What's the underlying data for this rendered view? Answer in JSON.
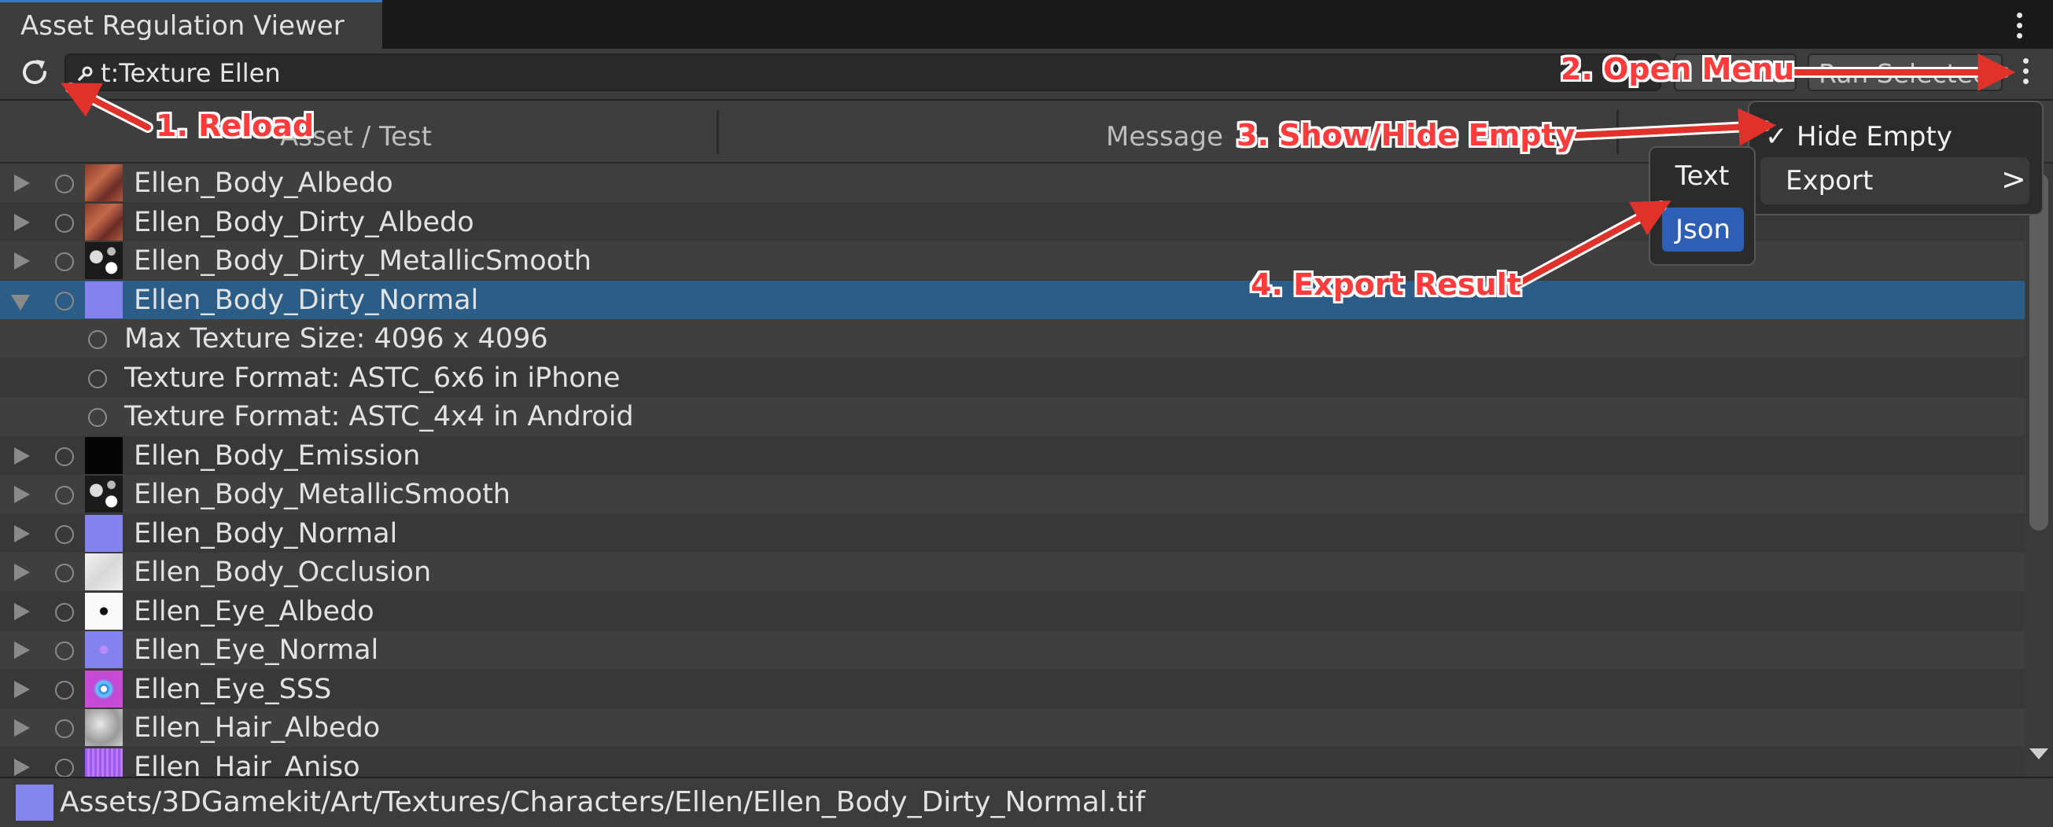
{
  "window": {
    "tab_title": "Asset Regulation Viewer"
  },
  "toolbar": {
    "search_value": "t:Texture Ellen",
    "run_selected_label": "Run Selected"
  },
  "columns": {
    "asset": "Asset / Test",
    "message": "Message"
  },
  "rows": [
    {
      "label": "Ellen_Body_Albedo",
      "kind": "asset",
      "expanded": false,
      "thumb": "albedo"
    },
    {
      "label": "Ellen_Body_Dirty_Albedo",
      "kind": "asset",
      "expanded": false,
      "thumb": "albedo"
    },
    {
      "label": "Ellen_Body_Dirty_MetallicSmooth",
      "kind": "asset",
      "expanded": false,
      "thumb": "metal"
    },
    {
      "label": "Ellen_Body_Dirty_Normal",
      "kind": "asset",
      "expanded": true,
      "selected": true,
      "thumb": "normal"
    },
    {
      "label": "Max Texture Size: 4096 x 4096",
      "kind": "test"
    },
    {
      "label": "Texture Format: ASTC_6x6 in iPhone",
      "kind": "test"
    },
    {
      "label": "Texture Format: ASTC_4x4 in Android",
      "kind": "test"
    },
    {
      "label": "Ellen_Body_Emission",
      "kind": "asset",
      "expanded": false,
      "thumb": "black"
    },
    {
      "label": "Ellen_Body_MetallicSmooth",
      "kind": "asset",
      "expanded": false,
      "thumb": "metal"
    },
    {
      "label": "Ellen_Body_Normal",
      "kind": "asset",
      "expanded": false,
      "thumb": "normal"
    },
    {
      "label": "Ellen_Body_Occlusion",
      "kind": "asset",
      "expanded": false,
      "thumb": "occlusion"
    },
    {
      "label": "Ellen_Eye_Albedo",
      "kind": "asset",
      "expanded": false,
      "thumb": "eye"
    },
    {
      "label": "Ellen_Eye_Normal",
      "kind": "asset",
      "expanded": false,
      "thumb": "eyenormal"
    },
    {
      "label": "Ellen_Eye_SSS",
      "kind": "asset",
      "expanded": false,
      "thumb": "sss"
    },
    {
      "label": "Ellen_Hair_Albedo",
      "kind": "asset",
      "expanded": false,
      "thumb": "hair"
    },
    {
      "label": "Ellen_Hair_Aniso",
      "kind": "asset",
      "expanded": false,
      "thumb": "aniso"
    }
  ],
  "status_bar": {
    "path": "Assets/3DGamekit/Art/Textures/Characters/Ellen/Ellen_Body_Dirty_Normal.tif"
  },
  "context_menu": {
    "hide_empty": {
      "label": "Hide Empty",
      "checked": true,
      "check_glyph": "✓"
    },
    "export": {
      "label": "Export",
      "chevron": ">"
    }
  },
  "export_submenu": {
    "text_label": "Text",
    "json_label": "Json"
  },
  "annotations": {
    "step1": "1. Reload",
    "step2": "2. Open Menu",
    "step3": "3. Show/Hide Empty",
    "step4": "4. Export Result",
    "color": "#ff3b3b"
  },
  "colors": {
    "selection": "#2c5d87",
    "accent_tab": "#3a79bb",
    "json_highlight": "#2e5fb5"
  }
}
